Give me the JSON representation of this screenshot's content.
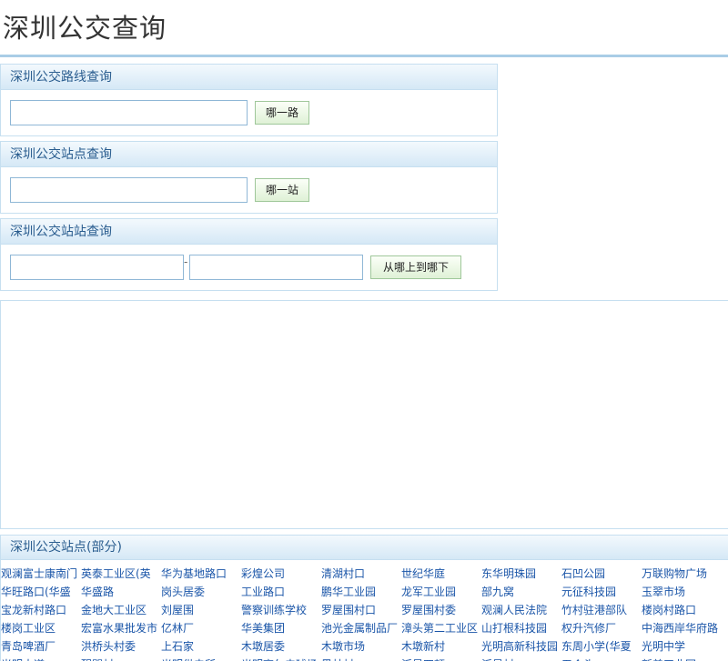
{
  "page": {
    "title": "深圳公交查询"
  },
  "route_panel": {
    "title": "深圳公交路线查询",
    "input_value": "",
    "button": "哪一路"
  },
  "station_panel": {
    "title": "深圳公交站点查询",
    "input_value": "",
    "button": "哪一站"
  },
  "transfer_panel": {
    "title": "深圳公交站站查询",
    "from_value": "",
    "separator": "-",
    "to_value": "",
    "button": "从哪上到哪下"
  },
  "stops": {
    "title": "深圳公交站点(部分)",
    "items": [
      "观澜富士康南门",
      "英泰工业区(英",
      "华为基地路口",
      "彩煌公司",
      "清湖村口",
      "世纪华庭",
      "东华明珠园",
      "石凹公园",
      "万联购物广场",
      "华旺路口(华盛",
      "华盛路",
      "岗头居委",
      "工业路口",
      "鹏华工业园",
      "龙军工业园",
      "部九窝",
      "元征科技园",
      "玉翠市场",
      "宝龙新村路口",
      "金地大工业区",
      "刘屋围",
      "警察训练学校",
      "罗屋围村口",
      "罗屋围村委",
      "观澜人民法院",
      "竹村驻港部队",
      "楼岗村路口",
      "楼岗工业区",
      "宏富水果批发市",
      "亿林厂",
      "华美集团",
      "池光金属制品厂",
      "漳头第二工业区",
      "山打根科技园",
      "权升汽修厂",
      "中海西岸华府路",
      "青岛啤酒厂",
      "洪桥头村委",
      "上石家",
      "木墩居委",
      "木墩市场",
      "木墩新村",
      "光明高新科技园",
      "东周小学(华夏",
      "光明中学",
      "光明大道",
      "醒閭村",
      "光明供电所",
      "光明高尔夫球场",
      "黑林村",
      "泛星四顿",
      "泛星村",
      "五个头",
      "新美工业园"
    ]
  }
}
